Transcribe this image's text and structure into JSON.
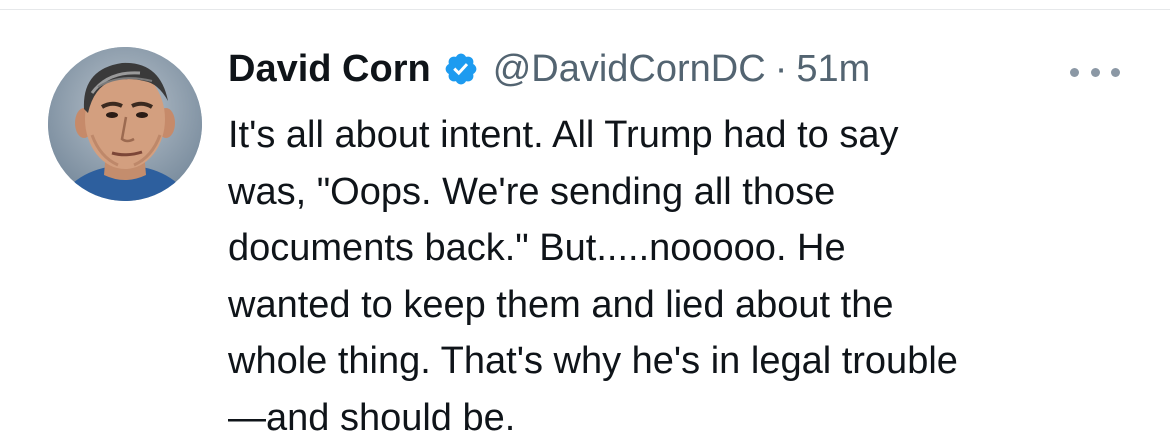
{
  "tweet": {
    "author": {
      "display_name": "David Corn",
      "verified": true,
      "handle": "@DavidCornDC"
    },
    "separator": "·",
    "time": "51m",
    "text_lines": [
      "It's all about intent. All Trump had to say",
      "was, \"Oops. We're sending all those",
      "documents back.\" But.....nooooo. He",
      "wanted to keep them and lied about the",
      "whole thing. That's why he's in legal trouble",
      "—and should be."
    ]
  },
  "colors": {
    "text_primary": "#0f1419",
    "text_secondary": "#536471",
    "verified_blue": "#1d9bf0"
  },
  "icons": {
    "verified": "verified-badge-icon",
    "more": "more-options-icon"
  }
}
